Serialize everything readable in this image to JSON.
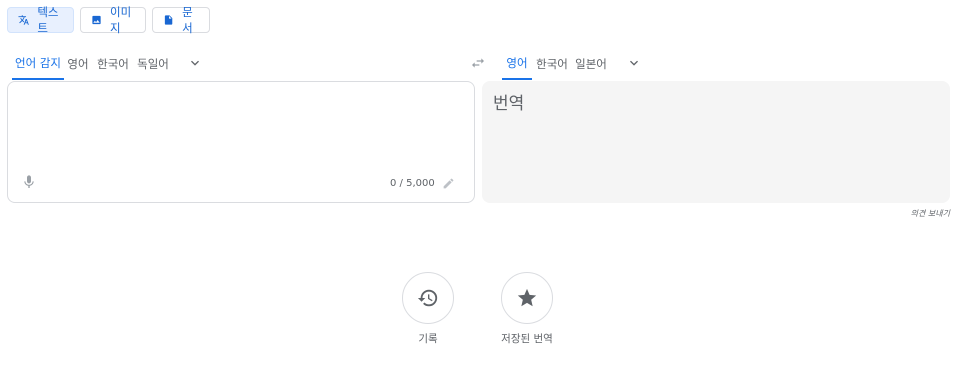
{
  "modes": [
    {
      "label": "텍스트",
      "icon": "translate-icon",
      "active": true
    },
    {
      "label": "이미지",
      "icon": "image-icon",
      "active": false
    },
    {
      "label": "문서",
      "icon": "document-icon",
      "active": false
    }
  ],
  "source_langs": [
    {
      "label": "언어 감지",
      "active": true
    },
    {
      "label": "영어",
      "active": false
    },
    {
      "label": "한국어",
      "active": false
    },
    {
      "label": "독일어",
      "active": false
    }
  ],
  "target_langs": [
    {
      "label": "영어",
      "active": true
    },
    {
      "label": "한국어",
      "active": false
    },
    {
      "label": "일본어",
      "active": false
    }
  ],
  "source": {
    "value": "",
    "char_count": "0 / 5,000"
  },
  "target": {
    "placeholder": "번역"
  },
  "feedback_label": "의견 보내기",
  "bottom_actions": [
    {
      "label": "기록",
      "icon": "history-icon"
    },
    {
      "label": "저장된 번역",
      "icon": "star-icon"
    }
  ],
  "colors": {
    "accent": "#1a73e8",
    "active_mode_bg": "#e8f0fe",
    "output_bg": "#f5f5f5"
  }
}
